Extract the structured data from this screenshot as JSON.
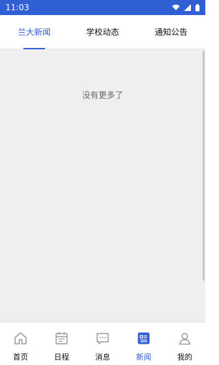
{
  "status_bar": {
    "time": "11:03",
    "icons": [
      "wifi-icon",
      "signal-icon",
      "battery-icon"
    ]
  },
  "tabs": [
    {
      "label": "兰大新闻",
      "active": true
    },
    {
      "label": "学校动态",
      "active": false
    },
    {
      "label": "通知公告",
      "active": false
    }
  ],
  "content": {
    "empty_message": "没有更多了"
  },
  "bottom_nav": [
    {
      "label": "首页",
      "icon": "home-icon",
      "active": false
    },
    {
      "label": "日程",
      "icon": "calendar-icon",
      "active": false
    },
    {
      "label": "消息",
      "icon": "message-icon",
      "active": false
    },
    {
      "label": "新闻",
      "icon": "news-icon",
      "active": true
    },
    {
      "label": "我的",
      "icon": "profile-icon",
      "active": false
    }
  ],
  "colors": {
    "accent": "#2f5fd2",
    "background": "#efefef",
    "icon_gray": "#9a9a9a"
  }
}
